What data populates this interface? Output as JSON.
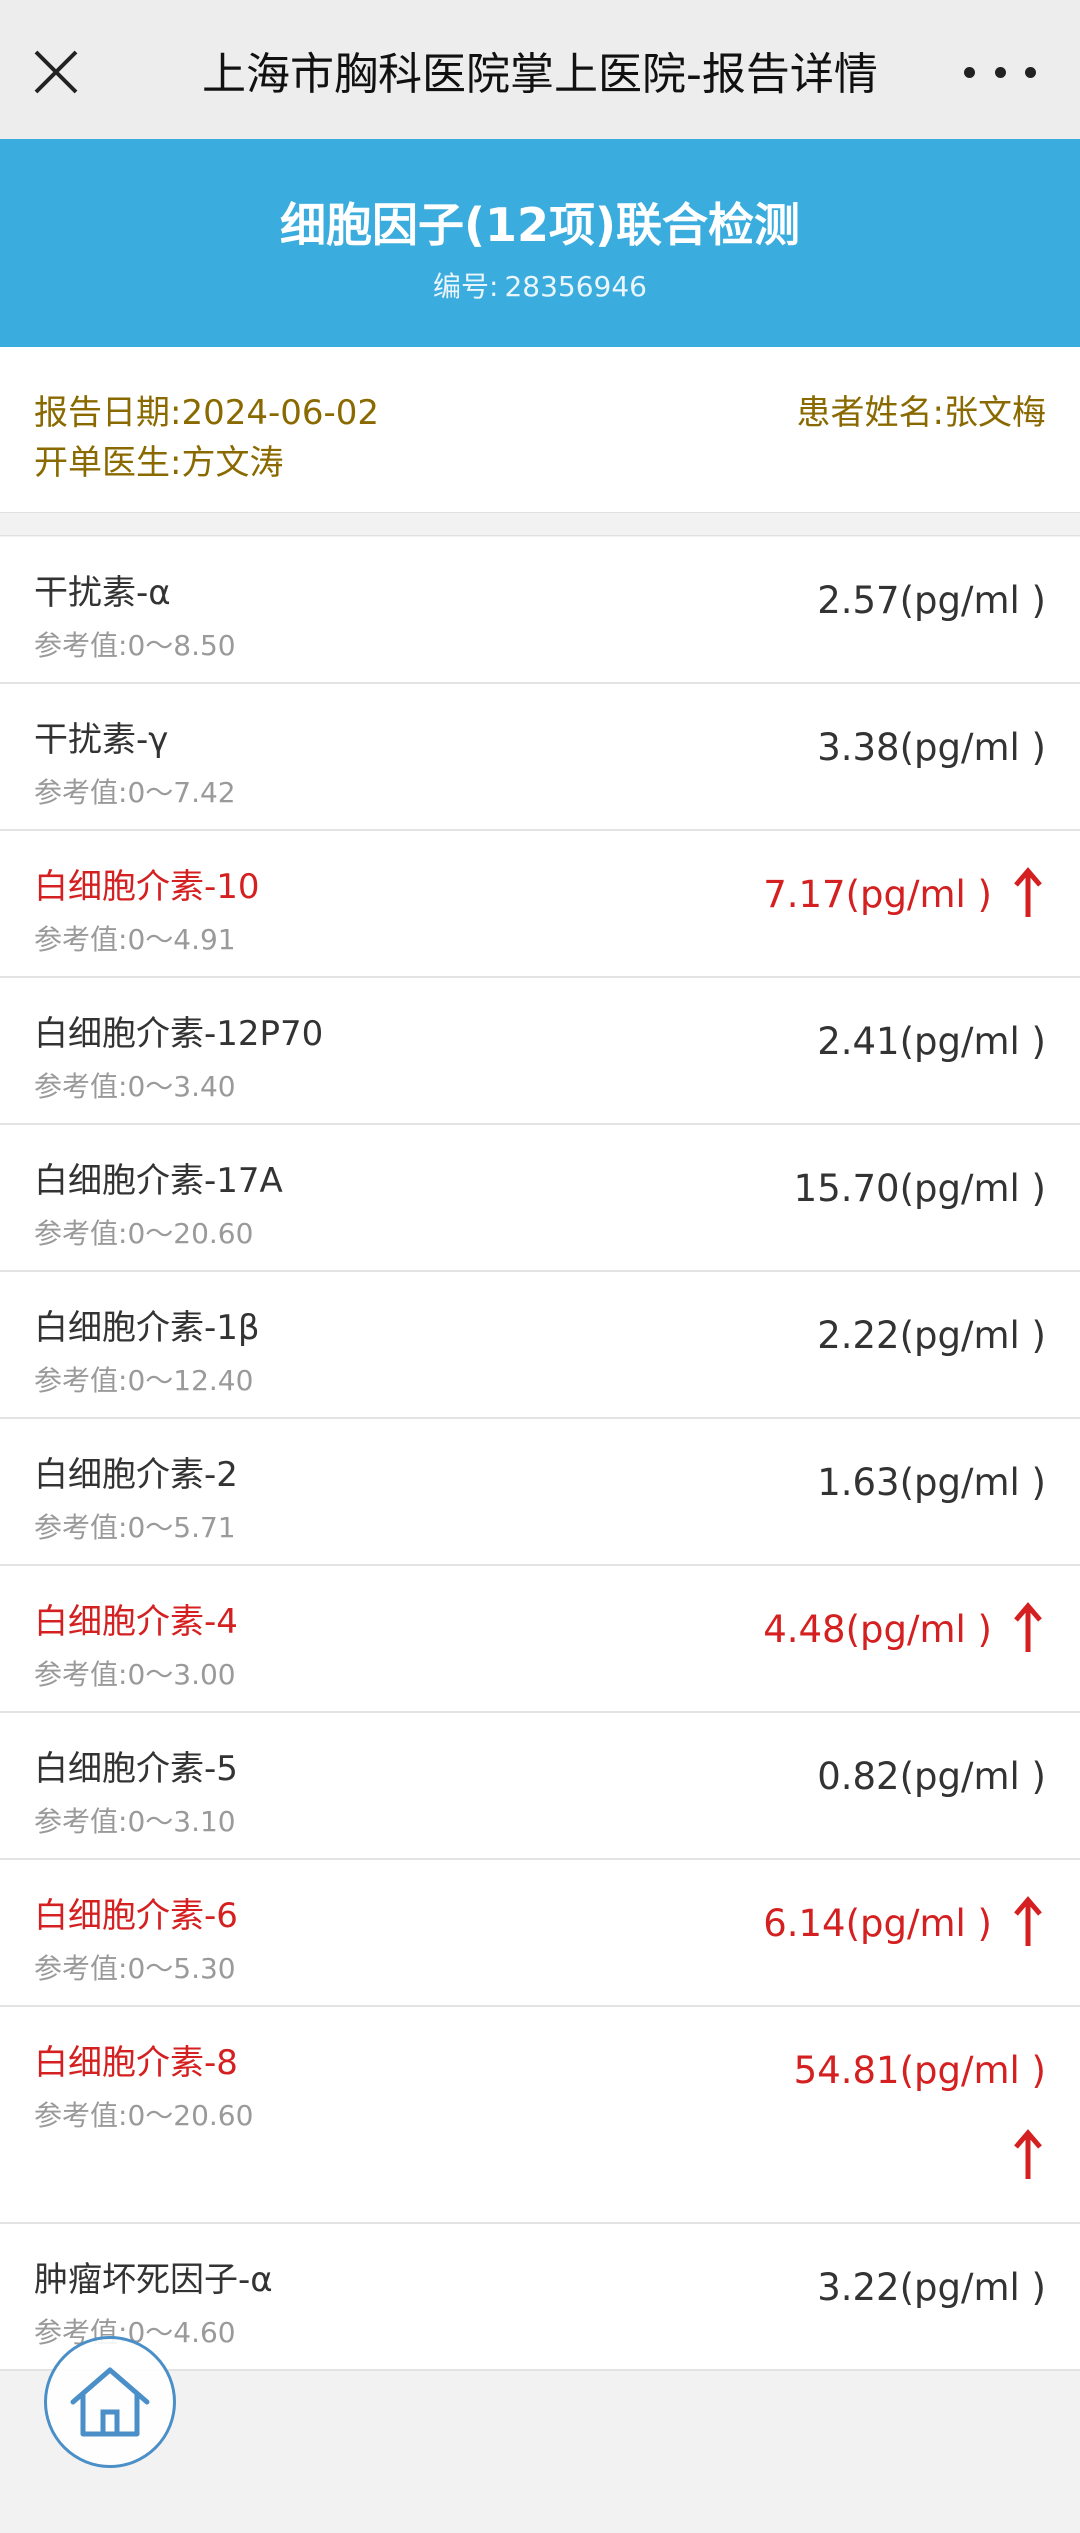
{
  "nav": {
    "title": "上海市胸科医院掌上医院-报告详情",
    "close_icon": "close-icon",
    "more_icon": "more-icon"
  },
  "report": {
    "title": "细胞因子(12项)联合检测",
    "number_label": "编号:",
    "number": "28356946"
  },
  "meta": {
    "date_label": "报告日期:",
    "date": "2024-06-02",
    "patient_label": "患者姓名:",
    "patient": "张文梅",
    "doctor_label": "开单医生:",
    "doctor": "方文涛"
  },
  "items": [
    {
      "name": "干扰素-α",
      "ref_label": "参考值:",
      "ref": "0～8.50",
      "value": "2.57(pg/ml )",
      "abnormal": false
    },
    {
      "name": "干扰素-γ",
      "ref_label": "参考值:",
      "ref": "0～7.42",
      "value": "3.38(pg/ml )",
      "abnormal": false
    },
    {
      "name": "白细胞介素-10",
      "ref_label": "参考值:",
      "ref": "0～4.91",
      "value": "7.17(pg/ml )",
      "abnormal": true
    },
    {
      "name": "白细胞介素-12P70",
      "ref_label": "参考值:",
      "ref": "0～3.40",
      "value": "2.41(pg/ml )",
      "abnormal": false
    },
    {
      "name": "白细胞介素-17A",
      "ref_label": "参考值:",
      "ref": "0～20.60",
      "value": "15.70(pg/ml )",
      "abnormal": false
    },
    {
      "name": "白细胞介素-1β",
      "ref_label": "参考值:",
      "ref": "0～12.40",
      "value": "2.22(pg/ml )",
      "abnormal": false
    },
    {
      "name": "白细胞介素-2",
      "ref_label": "参考值:",
      "ref": "0～5.71",
      "value": "1.63(pg/ml )",
      "abnormal": false
    },
    {
      "name": "白细胞介素-4",
      "ref_label": "参考值:",
      "ref": "0～3.00",
      "value": "4.48(pg/ml )",
      "abnormal": true
    },
    {
      "name": "白细胞介素-5",
      "ref_label": "参考值:",
      "ref": "0～3.10",
      "value": "0.82(pg/ml )",
      "abnormal": false
    },
    {
      "name": "白细胞介素-6",
      "ref_label": "参考值:",
      "ref": "0～5.30",
      "value": "6.14(pg/ml )",
      "abnormal": true
    },
    {
      "name": "白细胞介素-8",
      "ref_label": "参考值:",
      "ref": "0～20.60",
      "value": "54.81(pg/ml )",
      "abnormal": true
    },
    {
      "name": "肿瘤坏死因子-α",
      "ref_label": "参考值:",
      "ref": "0～4.60",
      "value": "3.22(pg/ml )",
      "abnormal": false
    }
  ],
  "colors": {
    "header_blue": "#3aacdd",
    "abnormal_red": "#d42020",
    "meta_gold": "#8a6a00"
  },
  "home_icon": "home-icon"
}
